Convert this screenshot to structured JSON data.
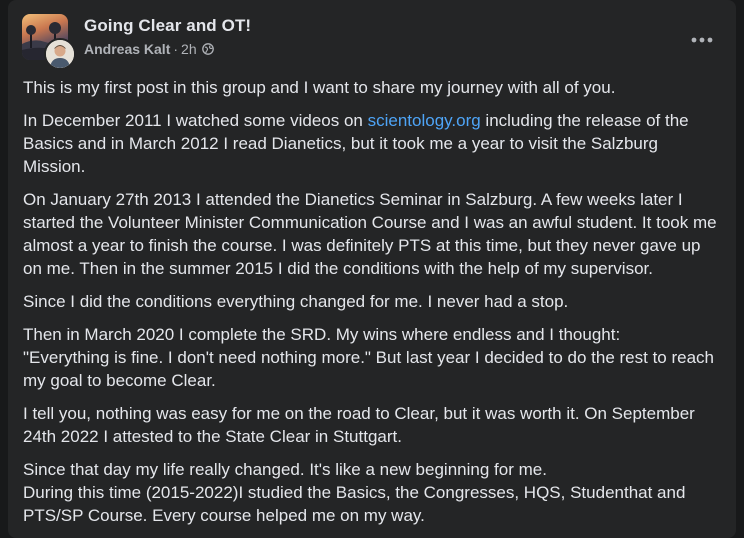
{
  "post": {
    "group_name": "Going Clear and OT!",
    "author": "Andreas Kalt",
    "time": "2h",
    "separator": "·",
    "audience_icon": "globe-icon",
    "more_icon": "more-options-icon",
    "paragraphs": {
      "p1": "This is my first post in this group and I want to share my journey with all of you.",
      "p2_before": "In December 2011 I watched some videos on ",
      "p2_link": "scientology.org",
      "p2_after": " including the release of the Basics and in March 2012 I read Dianetics, but it took me a year to visit the Salzburg Mission.",
      "p3": "On January 27th 2013 I attended the Dianetics Seminar in Salzburg. A few weeks later I started the Volunteer Minister Communication Course and I was an awful student. It took me almost a year to finish the course. I was definitely PTS at this time, but they never gave up on me. Then in the summer 2015 I did the conditions with the help of my supervisor.",
      "p4": "Since I did the conditions everything changed for me. I never had a stop.",
      "p5_line1": "Then in March 2020 I complete the SRD. My wins where endless and I thought:",
      "p5_rest": "\"Everything is fine. I don't need nothing more.\" But last year I decided to do the rest to reach my goal to become Clear.",
      "p6": "I tell you, nothing was easy for me on the road to Clear, but it was worth it. On September 24th 2022 I attested to the State Clear in Stuttgart.",
      "p7_line1": "Since that day my life really changed. It's like a new beginning for me.",
      "p7_rest": "During this time (2015-2022)I studied the Basics, the Congresses, HQS, Studenthat and PTS/SP Course. Every course helped me on my way."
    }
  },
  "colors": {
    "background": "#18191a",
    "card": "#242526",
    "primary_text": "#e4e6eb",
    "secondary_text": "#b0b3b8",
    "link": "#4ea4f6"
  }
}
